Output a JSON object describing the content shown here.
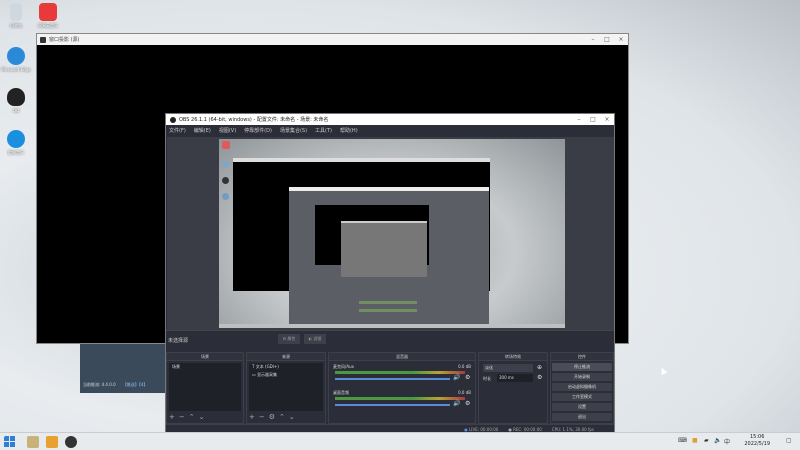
{
  "desktop": {
    "icons": [
      {
        "label": "网易云音乐",
        "color": "#e83a3a"
      },
      {
        "label": "回收站",
        "color": "#cfd8e0"
      },
      {
        "label": "Microsoft Edge",
        "color": "#2b8ad8"
      },
      {
        "label": "QQ",
        "color": "#222"
      },
      {
        "label": "酷狗音乐",
        "color": "#1a8fe0"
      }
    ]
  },
  "projector": {
    "title": "窗口投影 (源)"
  },
  "obs": {
    "title": "OBS 26.1.1 (64-bit, windows) - 配置文件: 未命名 - 场景: 未命名",
    "menu": [
      "文件(F)",
      "编辑(E)",
      "视图(V)",
      "停靠部件(D)",
      "场景集合(S)",
      "工具(T)",
      "帮助(H)"
    ],
    "status_label": "未选择源",
    "status_props": "属性",
    "status_filters": "滤镜",
    "docks": {
      "scenes": {
        "title": "场景",
        "items": [
          "场景"
        ]
      },
      "sources": {
        "title": "来源",
        "items": [
          "文本 (GDI+)",
          "显示器采集"
        ]
      },
      "mixer": {
        "title": "混音器",
        "tracks": [
          {
            "name": "麦克风/Aux",
            "db": "0.0 dB"
          },
          {
            "name": "桌面音频",
            "db": "0.0 dB"
          }
        ]
      },
      "transitions": {
        "title": "转场特效",
        "type": "淡化",
        "duration_label": "时长",
        "duration": "300 ms"
      },
      "controls": {
        "title": "控件",
        "buttons": [
          "停止推流",
          "开始录制",
          "启动虚拟摄像机",
          "工作室模式",
          "设置",
          "退出"
        ]
      }
    },
    "footer": {
      "live": "LIVE: 00:00:00",
      "rec": "REC: 00:00:00",
      "cpu": "CPU: 1.1%, 30.00 fps"
    }
  },
  "behind_window": {
    "text": "当前推流: 4.4.0.0",
    "link": "【推送】【4】"
  },
  "taskbar": {
    "time": "15:06",
    "date": "2022/5/19",
    "lang": "中"
  },
  "colors": {
    "obs_bg": "#2b2e38",
    "accent": "#5a8bd6"
  }
}
